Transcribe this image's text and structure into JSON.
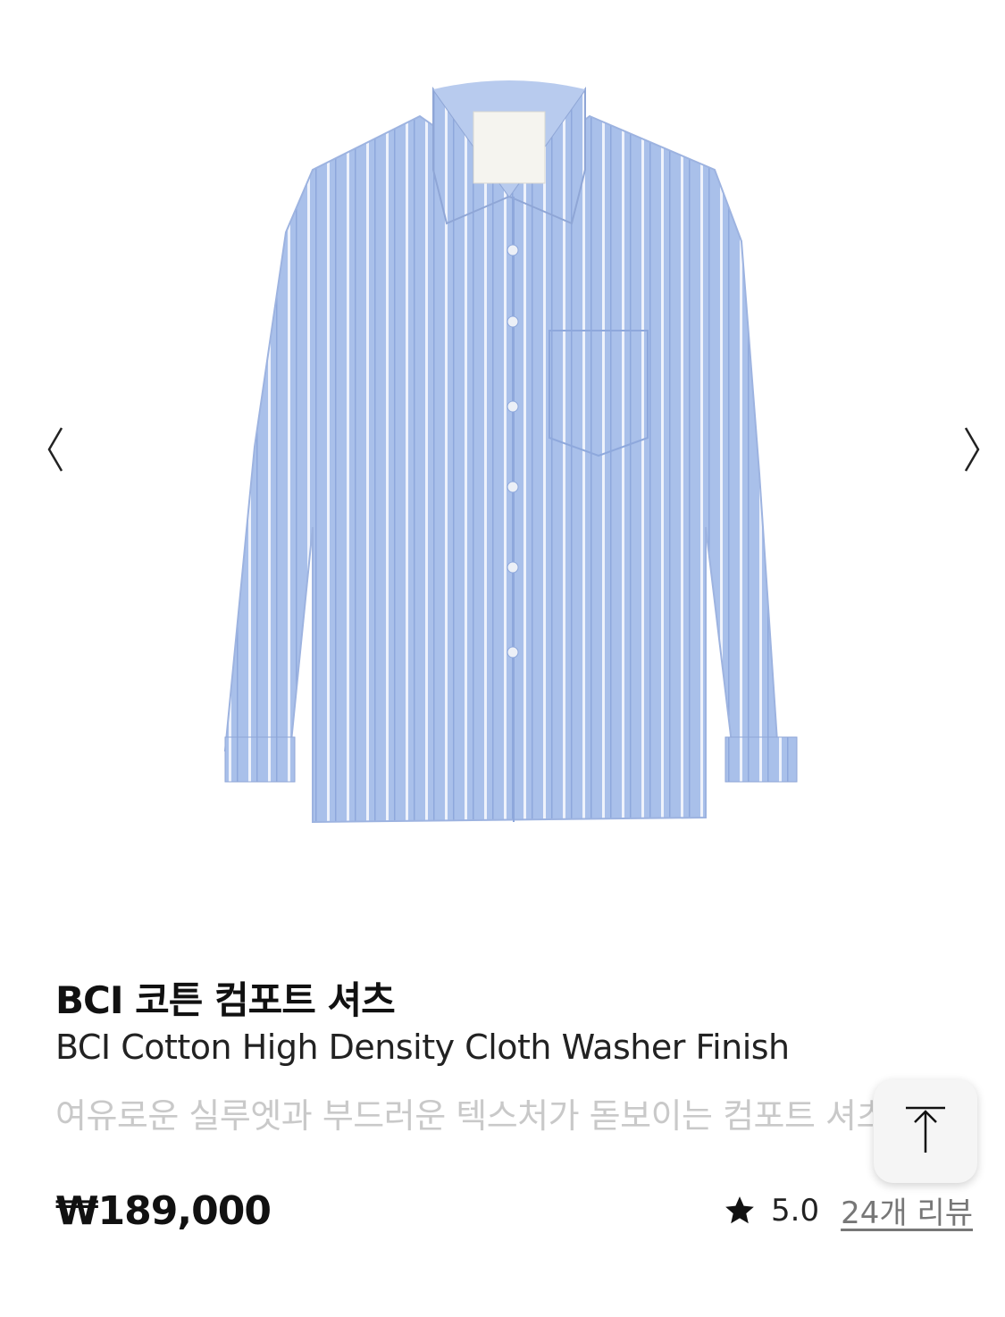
{
  "product": {
    "title_ko": "BCI 코튼 컴포트 셔츠",
    "title_en": "BCI Cotton High Density Cloth Washer Finish",
    "description": "여유로운 실루엣과 부드러운 텍스처가 돋보이는 컴포트 셔츠",
    "price": "₩189,000",
    "rating": "5.0",
    "reviews_link": "24개 리뷰"
  },
  "gallery": {
    "prev_icon": "chevron-left-icon",
    "next_icon": "chevron-right-icon"
  },
  "colors": {
    "shirt": "#a9c0ea",
    "stripe": "#f4f6fb",
    "text_primary": "#111111",
    "text_muted": "#c9c9c9"
  }
}
